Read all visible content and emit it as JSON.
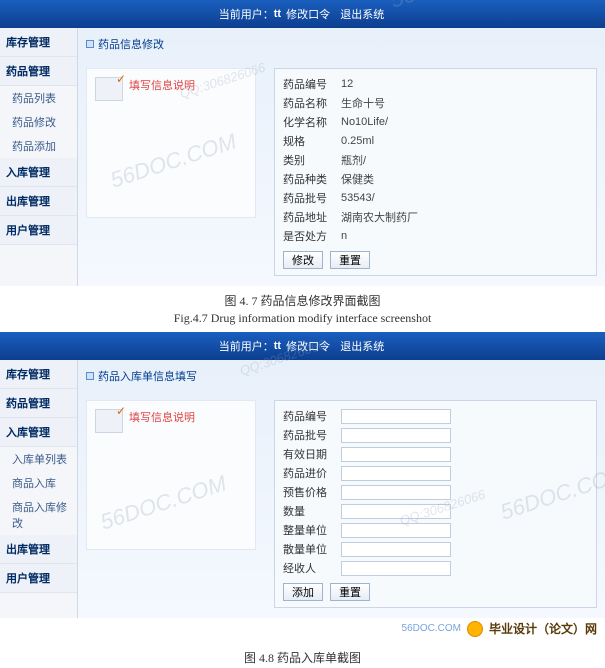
{
  "top": {
    "currentUserLabel": "当前用户：",
    "currentUser": "tt",
    "changePwd": "修改口令",
    "logout": "退出系统"
  },
  "fig1": {
    "caption_zh": "图 4. 7 药品信息修改界面截图",
    "caption_en": "Fig.4.7  Drug information modify interface screenshot",
    "panel_title": "药品信息修改",
    "note_title": "填写信息说明",
    "sidebar": {
      "g1": "库存管理",
      "g2": "药品管理",
      "g2_items": [
        "药品列表",
        "药品修改",
        "药品添加"
      ],
      "g3": "入库管理",
      "g4": "出库管理",
      "g5": "用户管理"
    },
    "fields": [
      {
        "label": "药品编号",
        "value": "12"
      },
      {
        "label": "药品名称",
        "value": "生命十号"
      },
      {
        "label": "化学名称",
        "value": "No10Life/"
      },
      {
        "label": "规格",
        "value": "0.25ml"
      },
      {
        "label": "类别",
        "value": "瓶剂/"
      },
      {
        "label": "药品种类",
        "value": "保健类"
      },
      {
        "label": "药品批号",
        "value": "53543/"
      },
      {
        "label": "药品地址",
        "value": "湖南农大制药厂"
      },
      {
        "label": "是否处方",
        "value": "n"
      }
    ],
    "btn_submit": "修改",
    "btn_reset": "重置"
  },
  "fig2": {
    "caption_zh": "图 4.8 药品入库单截图",
    "panel_title": "药品入库单信息填写",
    "note_title": "填写信息说明",
    "sidebar": {
      "g1": "库存管理",
      "g2": "药品管理",
      "g3": "入库管理",
      "g3_items": [
        "入库单列表",
        "商品入库",
        "商品入库修改"
      ],
      "g4": "出库管理",
      "g5": "用户管理"
    },
    "fields": [
      {
        "label": "药品编号"
      },
      {
        "label": "药品批号"
      },
      {
        "label": "有效日期"
      },
      {
        "label": "药品进价"
      },
      {
        "label": "预售价格"
      },
      {
        "label": "数量"
      },
      {
        "label": "整量单位"
      },
      {
        "label": "散量单位"
      },
      {
        "label": "经收人"
      }
    ],
    "btn_submit": "添加",
    "btn_reset": "重置"
  },
  "watermarks": {
    "main": "56DOC.COM",
    "small": "QQ:306826066",
    "brand": "毕业设计（论文）网",
    "brand_url": "56DOC.COM"
  }
}
